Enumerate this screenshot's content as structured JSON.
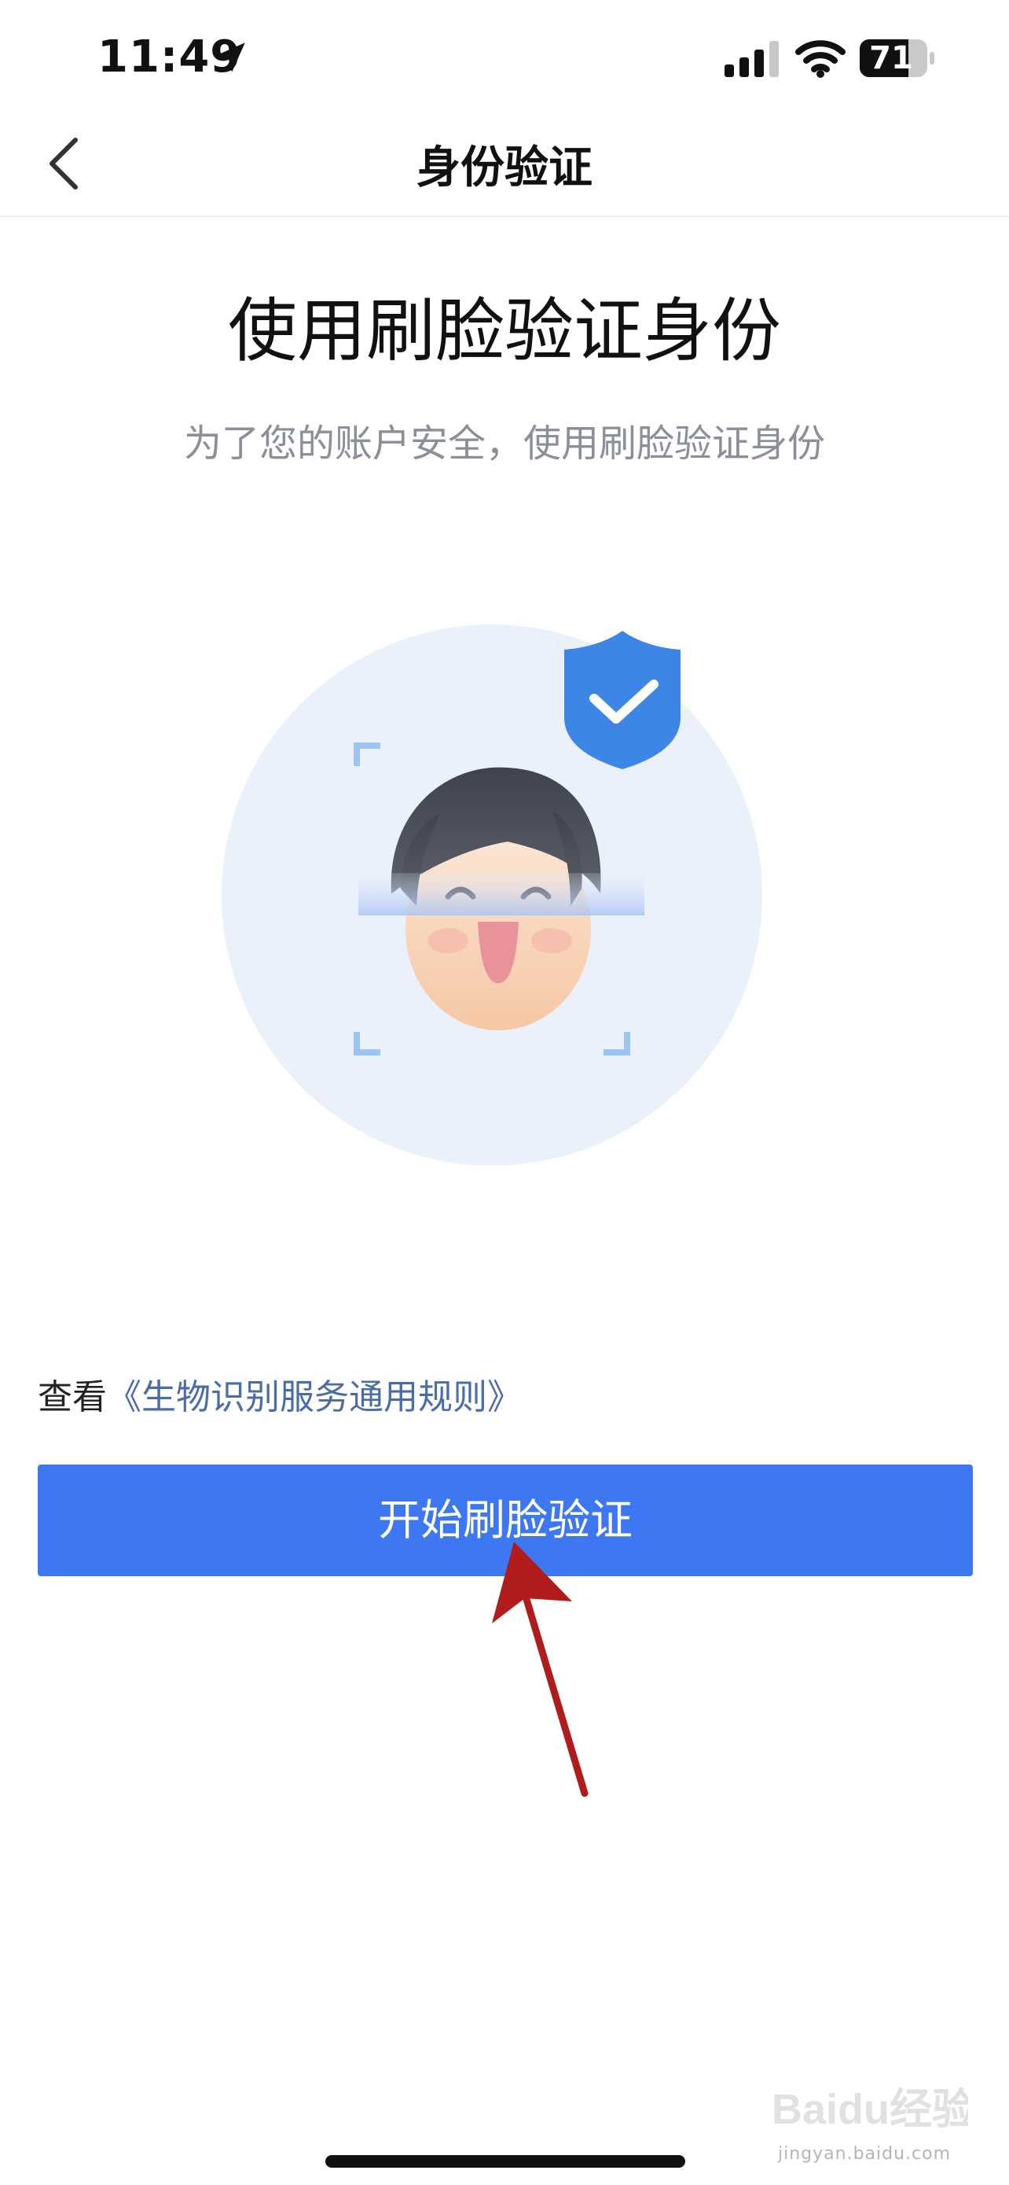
{
  "status_bar": {
    "time": "11:49",
    "battery_level": "71",
    "icons": [
      "location-arrow-icon",
      "cellular-signal-icon",
      "wifi-icon",
      "battery-icon"
    ]
  },
  "nav": {
    "title": "身份验证",
    "back_icon": "chevron-left-icon"
  },
  "main": {
    "heading": "使用刷脸验证身份",
    "subtitle": "为了您的账户安全，使用刷脸验证身份",
    "illustration_icons": [
      "face-illustration-icon",
      "shield-check-icon",
      "scan-frame-icon"
    ]
  },
  "rules": {
    "prefix": "查看",
    "link_text": "《生物识别服务通用规则》"
  },
  "primary_button": {
    "label": "开始刷脸验证"
  },
  "watermark": {
    "logo_text": "Baidu经验",
    "url_text": "jingyan.baidu.com"
  },
  "colors": {
    "accent": "#3d78f2",
    "link": "#4a6ca8",
    "subtitle": "#8a8f99",
    "annotation_arrow": "#b01c1c",
    "shield": "#3e86e6"
  }
}
